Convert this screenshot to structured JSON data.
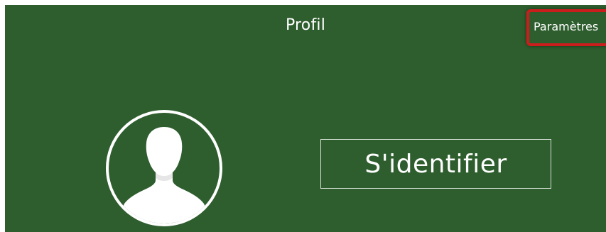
{
  "header": {
    "title": "Profil",
    "settings_label": "Paramètres"
  },
  "profile": {
    "avatar_icon": "person-silhouette-icon",
    "signin_label": "S'identifier"
  },
  "colors": {
    "background": "#2e5e2e",
    "highlight": "#cc1d1d",
    "text": "#ffffff"
  }
}
